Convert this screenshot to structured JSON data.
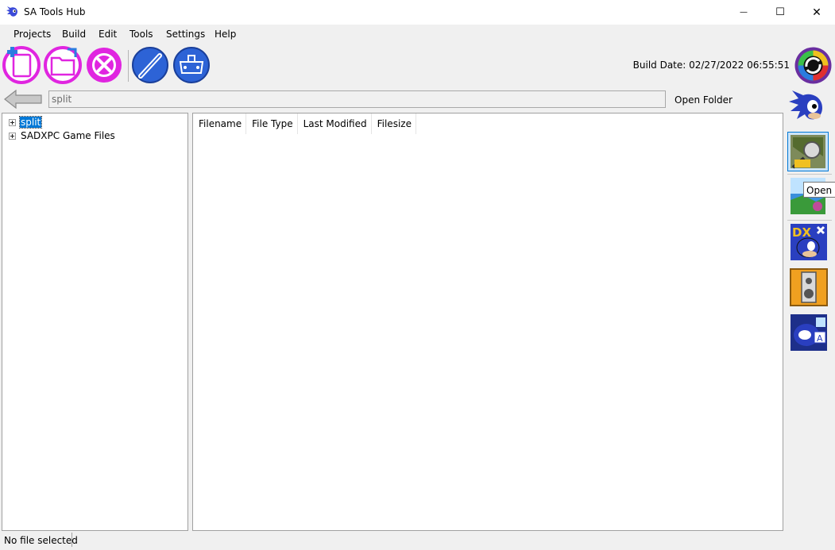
{
  "window": {
    "title": "SA Tools Hub",
    "app_icon": "sonic-head-icon",
    "controls": {
      "minimize_icon": "minimize-icon",
      "maximize_icon": "maximize-icon",
      "close_icon": "close-icon",
      "minimize_glyph": "—",
      "maximize_glyph": "☐",
      "close_glyph": "✕"
    }
  },
  "menu": {
    "items": [
      "Projects",
      "Build",
      "Edit",
      "Tools",
      "Settings",
      "Help"
    ]
  },
  "toolbar": {
    "buttons": [
      "new-project-icon",
      "open-project-icon",
      "project-settings-icon",
      "edit-tool-icon",
      "game-controller-icon"
    ],
    "build_date": "Build Date: 02/27/2022 06:55:51",
    "refresh_icon": "refresh-icon"
  },
  "path_bar": {
    "back_icon": "back-arrow-icon",
    "path_value": "split",
    "open_folder_label": "Open Folder"
  },
  "tree": {
    "nodes": [
      {
        "label": "split",
        "selected": true
      },
      {
        "label": "SADXPC Game Files",
        "selected": false
      }
    ]
  },
  "file_list": {
    "columns": [
      "Filename",
      "File Type",
      "Last Modified",
      "Filesize"
    ]
  },
  "sidebar": {
    "buttons": [
      "sonic-icon",
      "samdl-icon",
      "salvl-icon",
      "sadx-mod-loader-icon",
      "sound-tool-icon",
      "texture-editor-icon"
    ],
    "active_index": 1,
    "tooltip": "Open S"
  },
  "status": {
    "text": "No file selected"
  },
  "colors": {
    "accent": "#0078d7",
    "magenta": "#e025e0",
    "blue_tool": "#2d63d6"
  }
}
